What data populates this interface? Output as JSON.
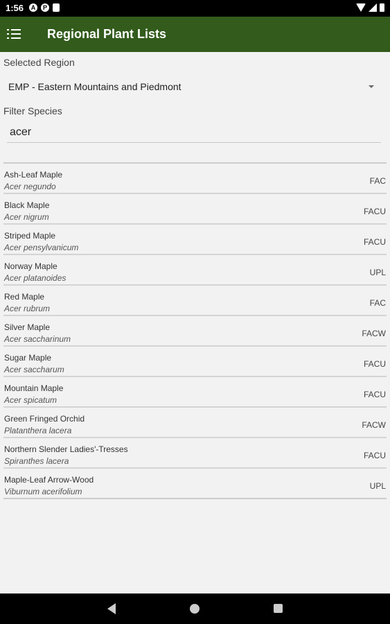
{
  "status_bar": {
    "time": "1:56",
    "icons": [
      "notification-a-icon",
      "notification-p-icon",
      "clipboard-icon",
      "wifi-icon",
      "signal-icon",
      "battery-icon"
    ]
  },
  "app_bar": {
    "title": "Regional Plant Lists",
    "menu_icon": "menu-icon",
    "background": "#325b1c"
  },
  "region": {
    "label": "Selected Region",
    "value": "EMP - Eastern Mountains and Piedmont"
  },
  "filter": {
    "label": "Filter Species",
    "value": "acer"
  },
  "species": [
    {
      "common": "Ash-Leaf Maple",
      "scientific": "Acer negundo",
      "status": "FAC"
    },
    {
      "common": "Black Maple",
      "scientific": "Acer nigrum",
      "status": "FACU"
    },
    {
      "common": "Striped Maple",
      "scientific": "Acer pensylvanicum",
      "status": "FACU"
    },
    {
      "common": "Norway Maple",
      "scientific": "Acer platanoides",
      "status": "UPL"
    },
    {
      "common": "Red Maple",
      "scientific": "Acer rubrum",
      "status": "FAC"
    },
    {
      "common": "Silver Maple",
      "scientific": "Acer saccharinum",
      "status": "FACW"
    },
    {
      "common": "Sugar Maple",
      "scientific": "Acer saccharum",
      "status": "FACU"
    },
    {
      "common": "Mountain Maple",
      "scientific": "Acer spicatum",
      "status": "FACU"
    },
    {
      "common": "Green Fringed Orchid",
      "scientific": "Platanthera lacera",
      "status": "FACW"
    },
    {
      "common": "Northern Slender Ladies'-Tresses",
      "scientific": "Spiranthes lacera",
      "status": "FACU"
    },
    {
      "common": "Maple-Leaf Arrow-Wood",
      "scientific": "Viburnum acerifolium",
      "status": "UPL"
    }
  ],
  "nav_bar": {
    "icons": [
      "back-icon",
      "home-icon",
      "recents-icon"
    ]
  }
}
